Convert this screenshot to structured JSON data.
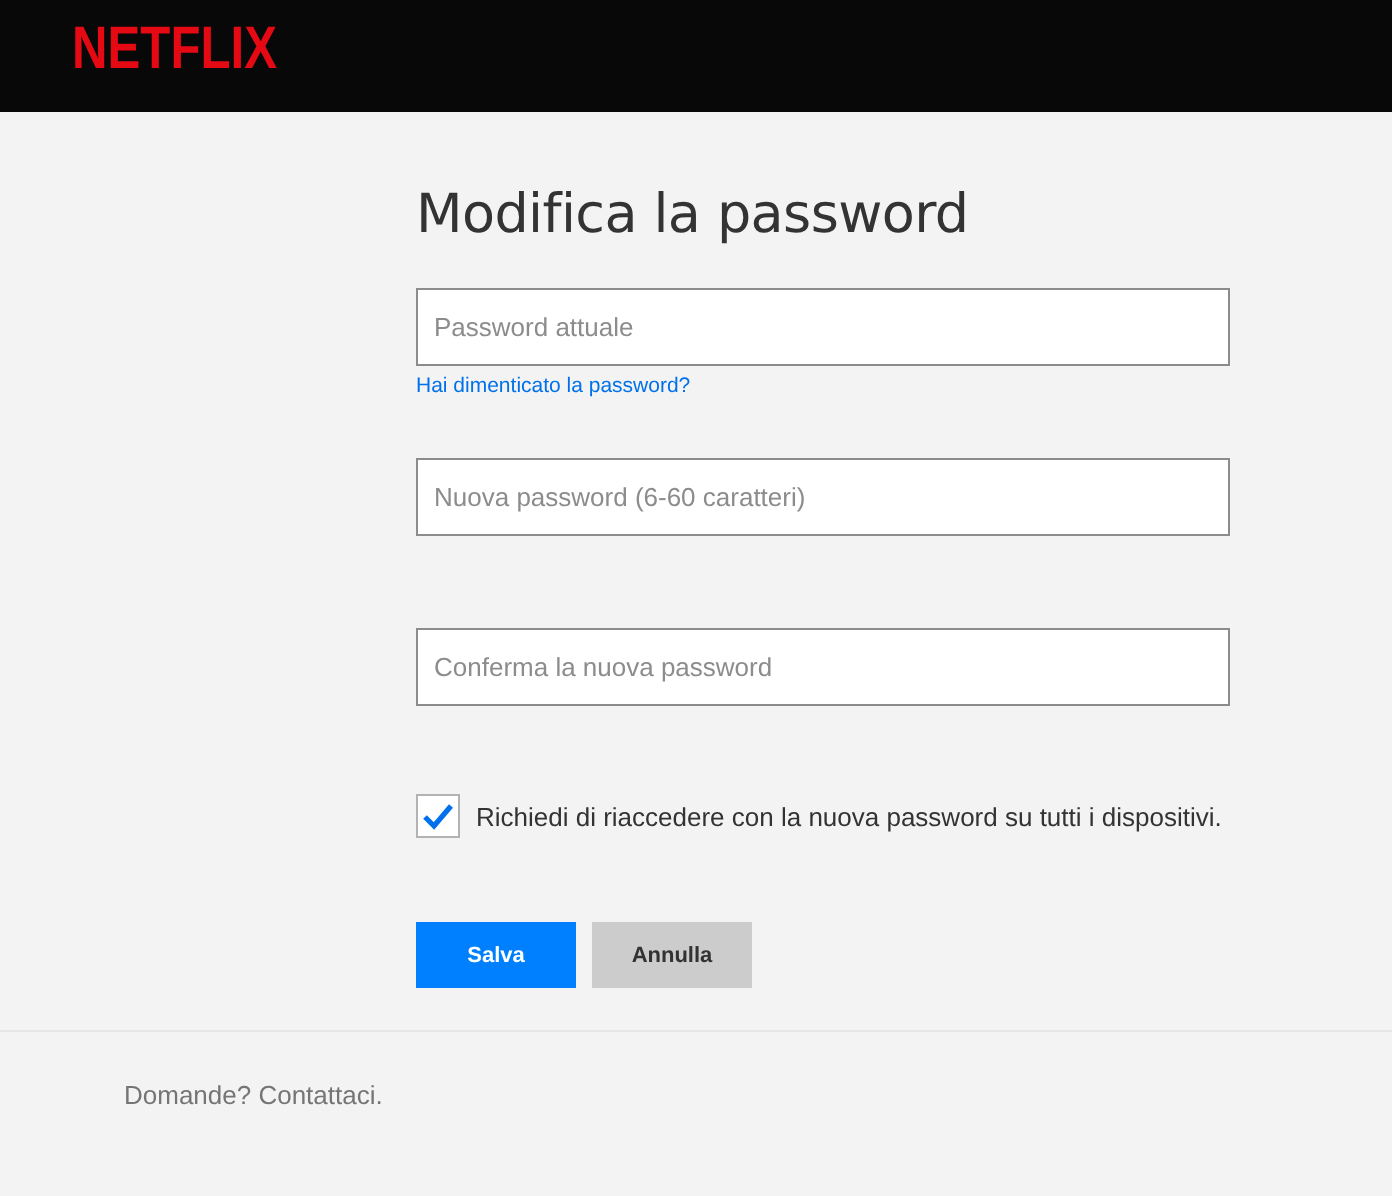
{
  "header": {
    "logo": "NETFLIX"
  },
  "title": "Modifica la password",
  "fields": [
    {
      "placeholder": "Password attuale",
      "link": "Hai dimenticato la password?"
    },
    {
      "placeholder": "Nuova password (6-60 caratteri)"
    },
    {
      "placeholder": "Conferma la nuova password"
    }
  ],
  "checkbox": {
    "label": "Richiedi di riaccedere con la nuova password su tutti i dispositivi.",
    "checked": true
  },
  "buttons": [
    {
      "label": "Salva",
      "kind": "primary"
    },
    {
      "label": "Annulla",
      "kind": "secondary"
    }
  ],
  "footer": {
    "text": "Domande? Contattaci."
  }
}
